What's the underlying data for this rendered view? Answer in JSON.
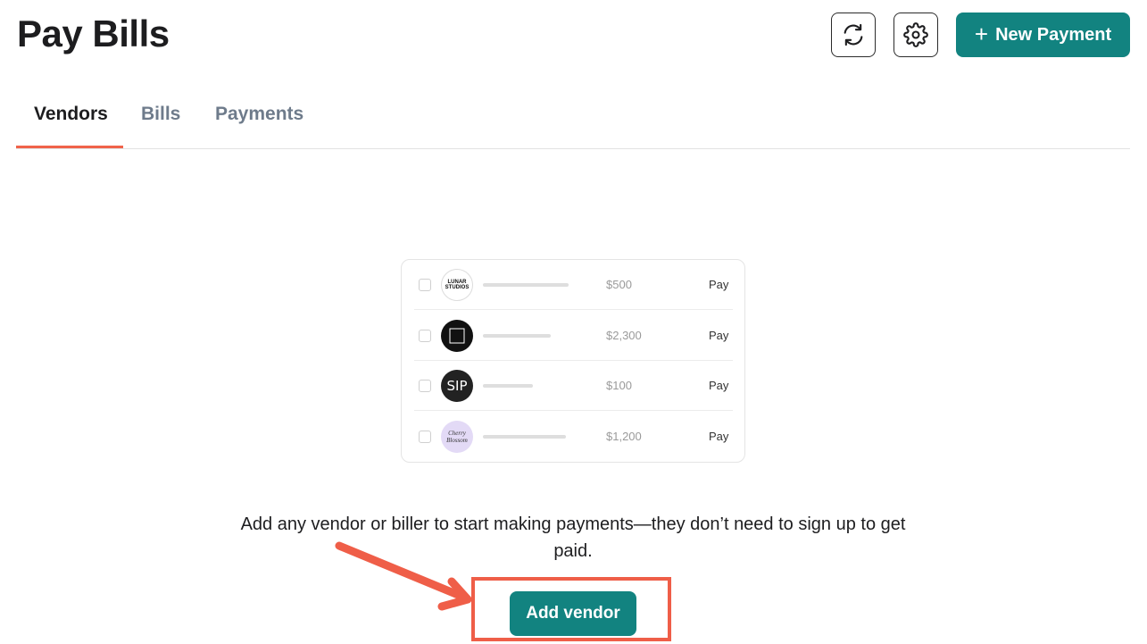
{
  "header": {
    "title": "Pay Bills",
    "new_payment_label": "New Payment"
  },
  "tabs": [
    {
      "label": "Vendors",
      "active": true
    },
    {
      "label": "Bills",
      "active": false
    },
    {
      "label": "Payments",
      "active": false
    }
  ],
  "illustration": {
    "rows": [
      {
        "logo": "LUNAR STUDIOS",
        "amount": "$500",
        "action": "Pay"
      },
      {
        "logo": "dark-square-logo",
        "amount": "$2,300",
        "action": "Pay"
      },
      {
        "logo": "SIP",
        "amount": "$100",
        "action": "Pay"
      },
      {
        "logo": "Cherry Blossom",
        "amount": "$1,200",
        "action": "Pay"
      }
    ]
  },
  "empty_state": {
    "message": "Add any vendor or biller to start making payments—they don’t need to sign up to get paid.",
    "button_label": "Add vendor"
  },
  "colors": {
    "primary": "#128380",
    "accent": "#f0634a",
    "annotation": "#ef5e48"
  },
  "icons": [
    "refresh-icon",
    "gear-icon",
    "plus-icon",
    "arrow-annotation"
  ]
}
